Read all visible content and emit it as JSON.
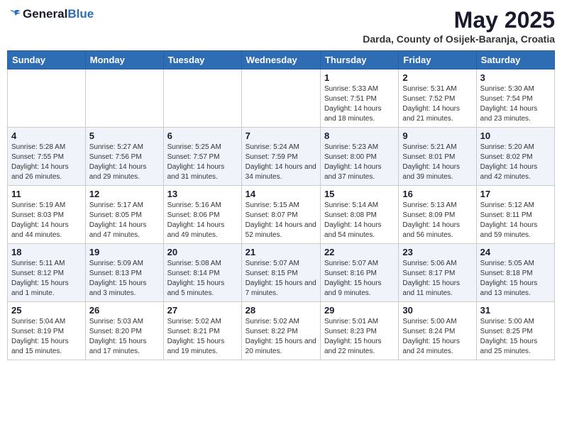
{
  "header": {
    "logo_general": "General",
    "logo_blue": "Blue",
    "month_year": "May 2025",
    "location": "Darda, County of Osijek-Baranja, Croatia"
  },
  "weekdays": [
    "Sunday",
    "Monday",
    "Tuesday",
    "Wednesday",
    "Thursday",
    "Friday",
    "Saturday"
  ],
  "weeks": [
    [
      {
        "day": "",
        "sunrise": "",
        "sunset": "",
        "daylight": ""
      },
      {
        "day": "",
        "sunrise": "",
        "sunset": "",
        "daylight": ""
      },
      {
        "day": "",
        "sunrise": "",
        "sunset": "",
        "daylight": ""
      },
      {
        "day": "",
        "sunrise": "",
        "sunset": "",
        "daylight": ""
      },
      {
        "day": "1",
        "sunrise": "Sunrise: 5:33 AM",
        "sunset": "Sunset: 7:51 PM",
        "daylight": "Daylight: 14 hours and 18 minutes."
      },
      {
        "day": "2",
        "sunrise": "Sunrise: 5:31 AM",
        "sunset": "Sunset: 7:52 PM",
        "daylight": "Daylight: 14 hours and 21 minutes."
      },
      {
        "day": "3",
        "sunrise": "Sunrise: 5:30 AM",
        "sunset": "Sunset: 7:54 PM",
        "daylight": "Daylight: 14 hours and 23 minutes."
      }
    ],
    [
      {
        "day": "4",
        "sunrise": "Sunrise: 5:28 AM",
        "sunset": "Sunset: 7:55 PM",
        "daylight": "Daylight: 14 hours and 26 minutes."
      },
      {
        "day": "5",
        "sunrise": "Sunrise: 5:27 AM",
        "sunset": "Sunset: 7:56 PM",
        "daylight": "Daylight: 14 hours and 29 minutes."
      },
      {
        "day": "6",
        "sunrise": "Sunrise: 5:25 AM",
        "sunset": "Sunset: 7:57 PM",
        "daylight": "Daylight: 14 hours and 31 minutes."
      },
      {
        "day": "7",
        "sunrise": "Sunrise: 5:24 AM",
        "sunset": "Sunset: 7:59 PM",
        "daylight": "Daylight: 14 hours and 34 minutes."
      },
      {
        "day": "8",
        "sunrise": "Sunrise: 5:23 AM",
        "sunset": "Sunset: 8:00 PM",
        "daylight": "Daylight: 14 hours and 37 minutes."
      },
      {
        "day": "9",
        "sunrise": "Sunrise: 5:21 AM",
        "sunset": "Sunset: 8:01 PM",
        "daylight": "Daylight: 14 hours and 39 minutes."
      },
      {
        "day": "10",
        "sunrise": "Sunrise: 5:20 AM",
        "sunset": "Sunset: 8:02 PM",
        "daylight": "Daylight: 14 hours and 42 minutes."
      }
    ],
    [
      {
        "day": "11",
        "sunrise": "Sunrise: 5:19 AM",
        "sunset": "Sunset: 8:03 PM",
        "daylight": "Daylight: 14 hours and 44 minutes."
      },
      {
        "day": "12",
        "sunrise": "Sunrise: 5:17 AM",
        "sunset": "Sunset: 8:05 PM",
        "daylight": "Daylight: 14 hours and 47 minutes."
      },
      {
        "day": "13",
        "sunrise": "Sunrise: 5:16 AM",
        "sunset": "Sunset: 8:06 PM",
        "daylight": "Daylight: 14 hours and 49 minutes."
      },
      {
        "day": "14",
        "sunrise": "Sunrise: 5:15 AM",
        "sunset": "Sunset: 8:07 PM",
        "daylight": "Daylight: 14 hours and 52 minutes."
      },
      {
        "day": "15",
        "sunrise": "Sunrise: 5:14 AM",
        "sunset": "Sunset: 8:08 PM",
        "daylight": "Daylight: 14 hours and 54 minutes."
      },
      {
        "day": "16",
        "sunrise": "Sunrise: 5:13 AM",
        "sunset": "Sunset: 8:09 PM",
        "daylight": "Daylight: 14 hours and 56 minutes."
      },
      {
        "day": "17",
        "sunrise": "Sunrise: 5:12 AM",
        "sunset": "Sunset: 8:11 PM",
        "daylight": "Daylight: 14 hours and 59 minutes."
      }
    ],
    [
      {
        "day": "18",
        "sunrise": "Sunrise: 5:11 AM",
        "sunset": "Sunset: 8:12 PM",
        "daylight": "Daylight: 15 hours and 1 minute."
      },
      {
        "day": "19",
        "sunrise": "Sunrise: 5:09 AM",
        "sunset": "Sunset: 8:13 PM",
        "daylight": "Daylight: 15 hours and 3 minutes."
      },
      {
        "day": "20",
        "sunrise": "Sunrise: 5:08 AM",
        "sunset": "Sunset: 8:14 PM",
        "daylight": "Daylight: 15 hours and 5 minutes."
      },
      {
        "day": "21",
        "sunrise": "Sunrise: 5:07 AM",
        "sunset": "Sunset: 8:15 PM",
        "daylight": "Daylight: 15 hours and 7 minutes."
      },
      {
        "day": "22",
        "sunrise": "Sunrise: 5:07 AM",
        "sunset": "Sunset: 8:16 PM",
        "daylight": "Daylight: 15 hours and 9 minutes."
      },
      {
        "day": "23",
        "sunrise": "Sunrise: 5:06 AM",
        "sunset": "Sunset: 8:17 PM",
        "daylight": "Daylight: 15 hours and 11 minutes."
      },
      {
        "day": "24",
        "sunrise": "Sunrise: 5:05 AM",
        "sunset": "Sunset: 8:18 PM",
        "daylight": "Daylight: 15 hours and 13 minutes."
      }
    ],
    [
      {
        "day": "25",
        "sunrise": "Sunrise: 5:04 AM",
        "sunset": "Sunset: 8:19 PM",
        "daylight": "Daylight: 15 hours and 15 minutes."
      },
      {
        "day": "26",
        "sunrise": "Sunrise: 5:03 AM",
        "sunset": "Sunset: 8:20 PM",
        "daylight": "Daylight: 15 hours and 17 minutes."
      },
      {
        "day": "27",
        "sunrise": "Sunrise: 5:02 AM",
        "sunset": "Sunset: 8:21 PM",
        "daylight": "Daylight: 15 hours and 19 minutes."
      },
      {
        "day": "28",
        "sunrise": "Sunrise: 5:02 AM",
        "sunset": "Sunset: 8:22 PM",
        "daylight": "Daylight: 15 hours and 20 minutes."
      },
      {
        "day": "29",
        "sunrise": "Sunrise: 5:01 AM",
        "sunset": "Sunset: 8:23 PM",
        "daylight": "Daylight: 15 hours and 22 minutes."
      },
      {
        "day": "30",
        "sunrise": "Sunrise: 5:00 AM",
        "sunset": "Sunset: 8:24 PM",
        "daylight": "Daylight: 15 hours and 24 minutes."
      },
      {
        "day": "31",
        "sunrise": "Sunrise: 5:00 AM",
        "sunset": "Sunset: 8:25 PM",
        "daylight": "Daylight: 15 hours and 25 minutes."
      }
    ]
  ]
}
